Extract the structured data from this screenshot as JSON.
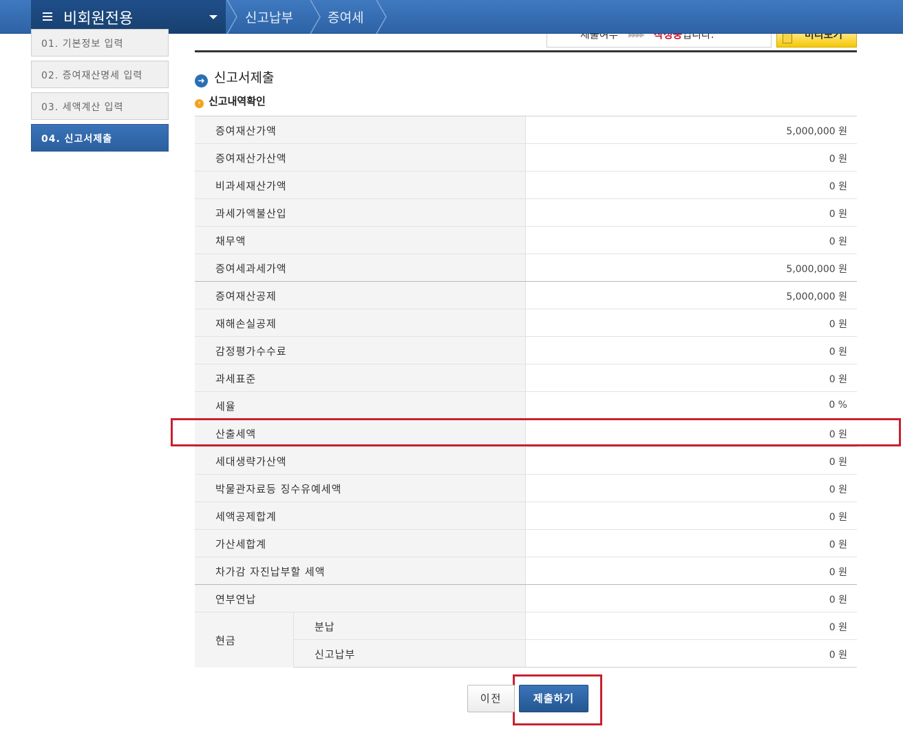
{
  "header": {
    "menu_title": "비회원전용",
    "breadcrumbs": [
      "신고납부",
      "증여세"
    ]
  },
  "sidebar": {
    "items": [
      {
        "label": "01. 기본정보 입력",
        "active": false
      },
      {
        "label": "02. 증여재산명세 입력",
        "active": false
      },
      {
        "label": "03. 세액계산 입력",
        "active": false
      },
      {
        "label": "04. 신고서제출",
        "active": true
      }
    ]
  },
  "status": {
    "prefix": "제출여부",
    "highlight": "작성중",
    "suffix": "입니다.",
    "preview_label": "미리보기"
  },
  "section": {
    "title": "신고서제출",
    "subtitle": "신고내역확인"
  },
  "table": {
    "rows": [
      {
        "label": "증여재산가액",
        "value": "5,000,000 원"
      },
      {
        "label": "증여재산가산액",
        "value": "0 원"
      },
      {
        "label": "비과세재산가액",
        "value": "0 원"
      },
      {
        "label": "과세가액불산입",
        "value": "0 원"
      },
      {
        "label": "채무액",
        "value": "0 원"
      },
      {
        "label": "증여세과세가액",
        "value": "5,000,000 원"
      },
      {
        "label": "증여재산공제",
        "value": "5,000,000 원"
      },
      {
        "label": "재해손실공제",
        "value": "0 원"
      },
      {
        "label": "감정평가수수료",
        "value": "0 원"
      },
      {
        "label": "과세표준",
        "value": "0 원"
      },
      {
        "label": "세율",
        "value": "0 %"
      },
      {
        "label": "산출세액",
        "value": "0 원"
      },
      {
        "label": "세대생략가산액",
        "value": "0 원"
      },
      {
        "label": "박물관자료등 징수유예세액",
        "value": "0 원"
      },
      {
        "label": "세액공제합계",
        "value": "0 원"
      },
      {
        "label": "가산세합계",
        "value": "0 원"
      },
      {
        "label": "차가감 자진납부할 세액",
        "value": "0 원"
      },
      {
        "label": "연부연납",
        "value": "0 원"
      }
    ],
    "cash": {
      "label": "현금",
      "rows": [
        {
          "label": "분납",
          "value": "0 원"
        },
        {
          "label": "신고납부",
          "value": "0 원"
        }
      ]
    }
  },
  "buttons": {
    "prev": "이전",
    "submit": "제출하기"
  }
}
